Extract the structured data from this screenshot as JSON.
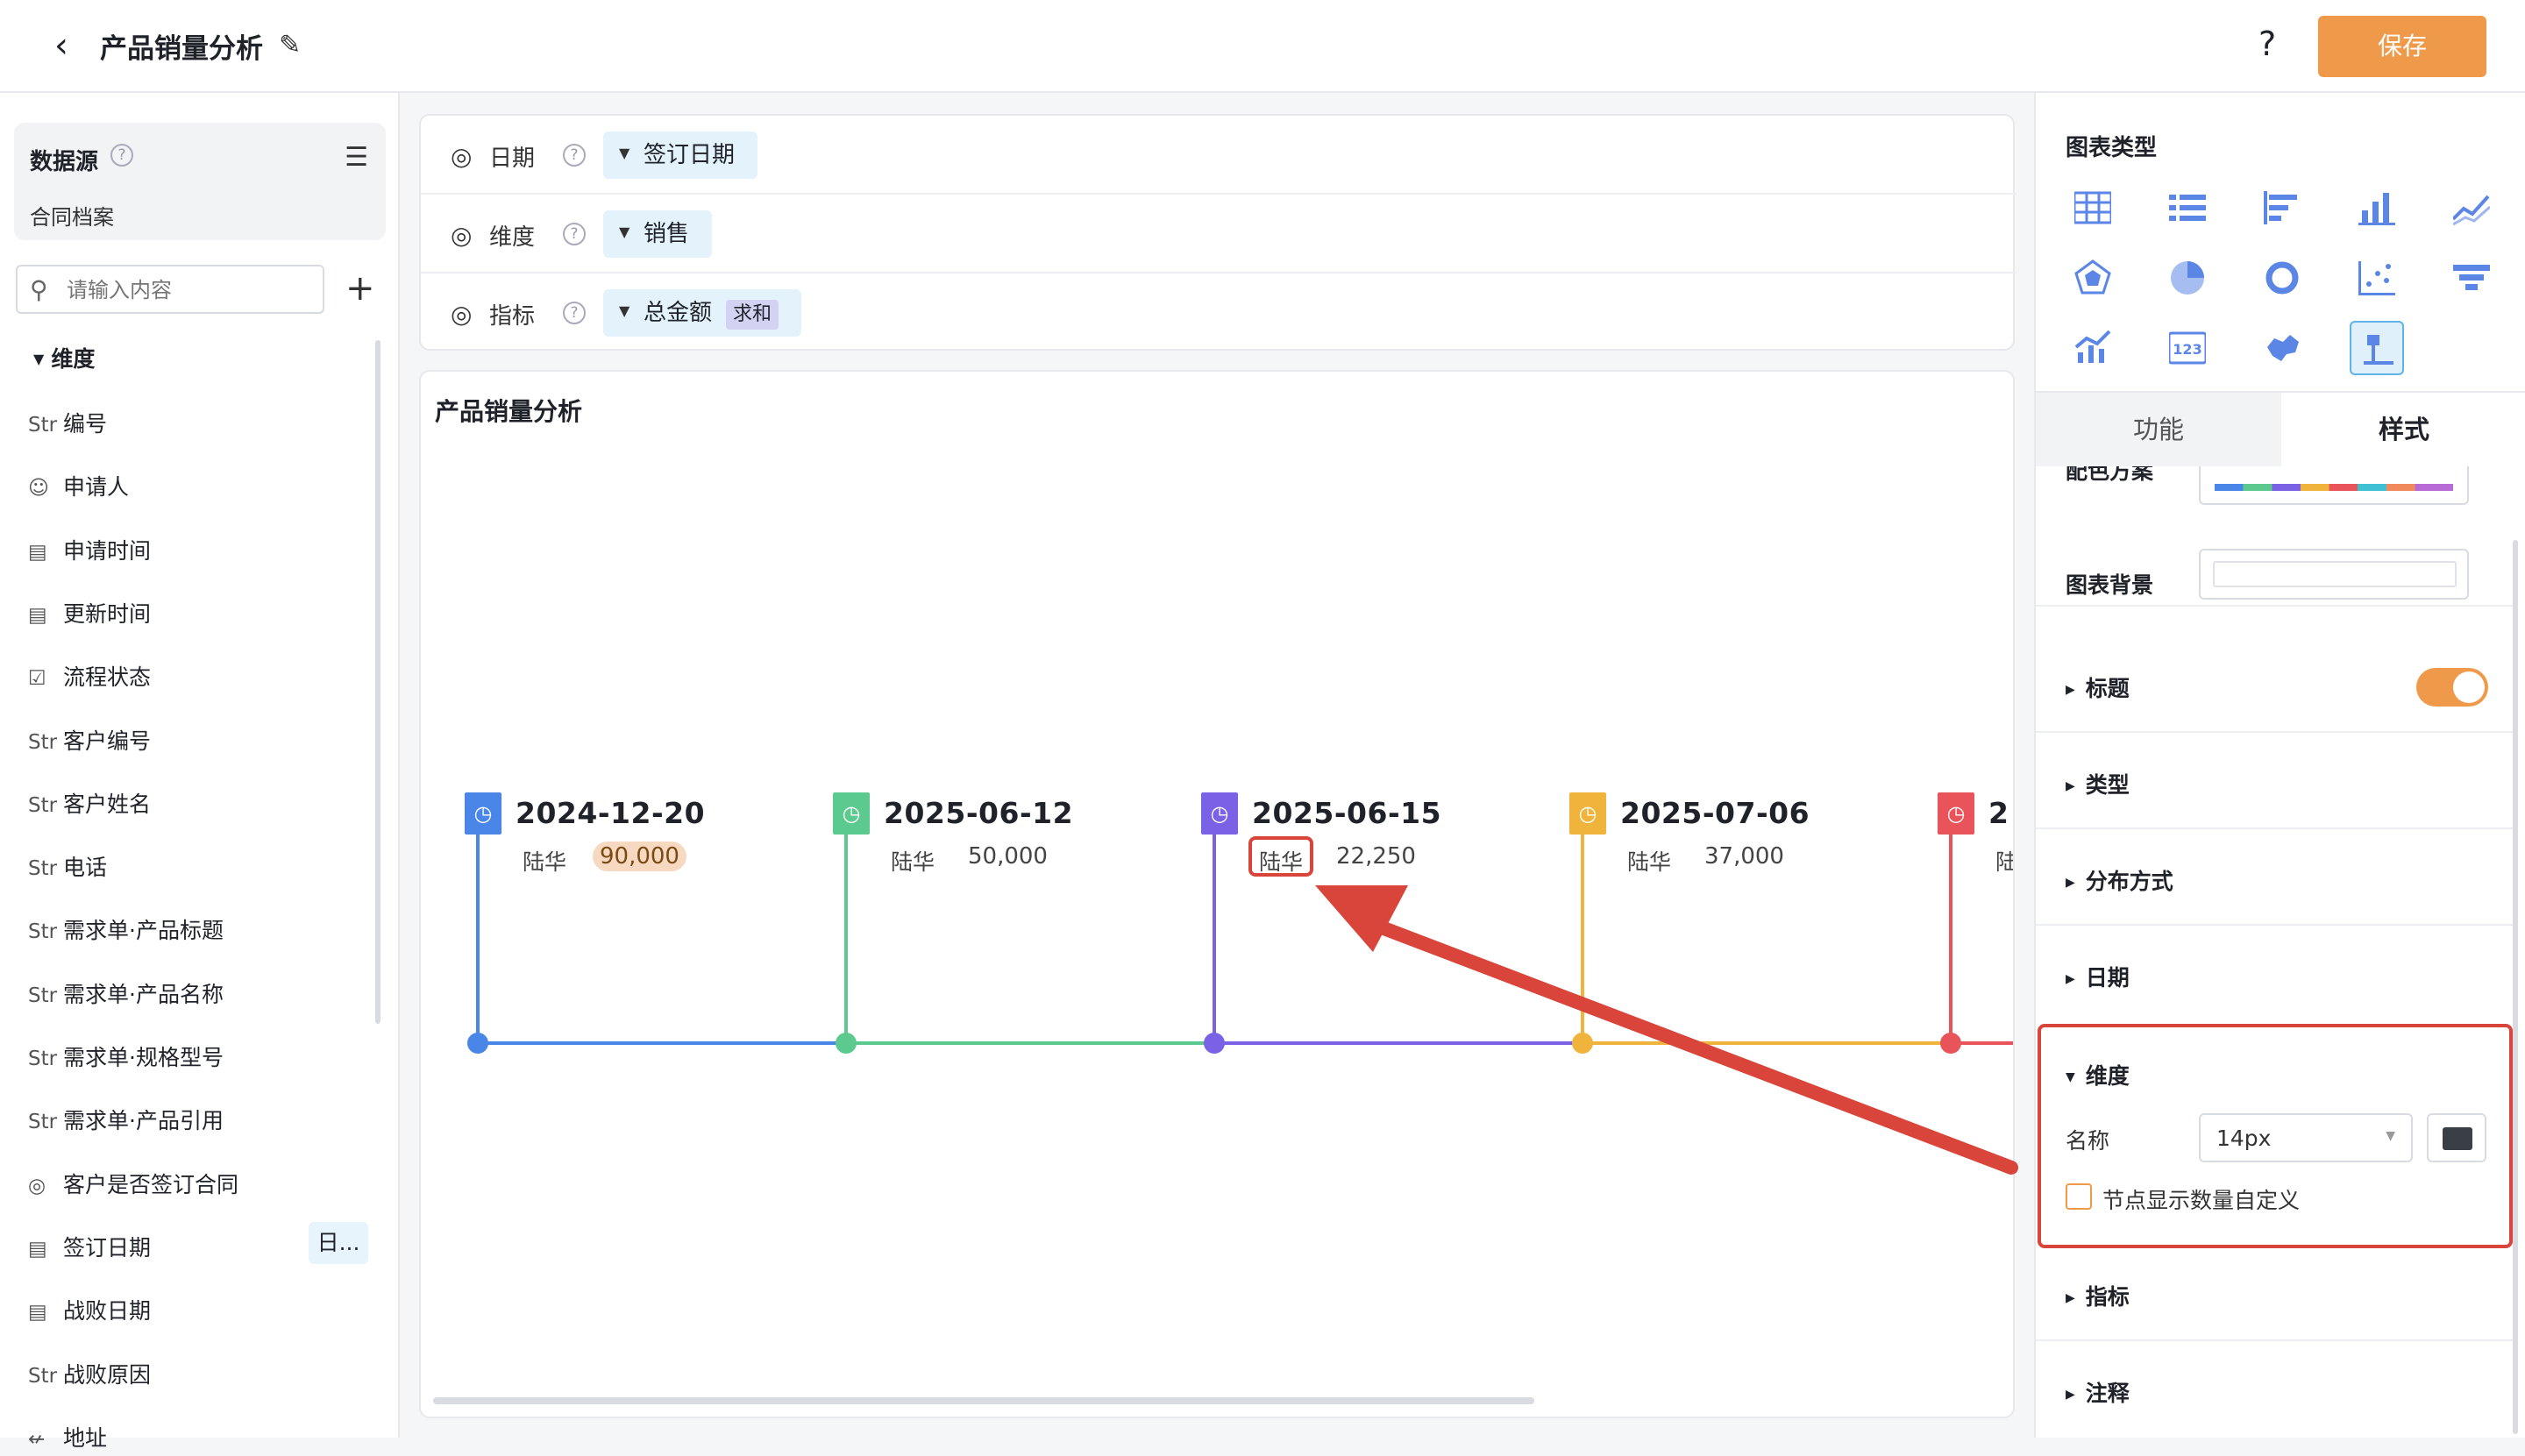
{
  "topbar": {
    "title": "产品销量分析",
    "save_label": "保存",
    "help": "?"
  },
  "left": {
    "datasource_label": "数据源",
    "datasource_name": "合同档案",
    "search_placeholder": "请输入内容",
    "dimension_header": "维度",
    "fields": [
      {
        "type": "Str",
        "name": "编号",
        "icon": "string-icon"
      },
      {
        "type": "person",
        "name": "申请人",
        "icon": "person-icon"
      },
      {
        "type": "date",
        "name": "申请时间",
        "icon": "calendar-icon"
      },
      {
        "type": "date",
        "name": "更新时间",
        "icon": "calendar-icon"
      },
      {
        "type": "check",
        "name": "流程状态",
        "icon": "checkbox-icon"
      },
      {
        "type": "Str",
        "name": "客户编号",
        "icon": "string-icon"
      },
      {
        "type": "Str",
        "name": "客户姓名",
        "icon": "string-icon"
      },
      {
        "type": "Str",
        "name": "电话",
        "icon": "string-icon"
      },
      {
        "type": "Str",
        "name": "需求单·产品标题",
        "icon": "string-icon"
      },
      {
        "type": "Str",
        "name": "需求单·产品名称",
        "icon": "string-icon"
      },
      {
        "type": "Str",
        "name": "需求单·规格型号",
        "icon": "string-icon"
      },
      {
        "type": "Str",
        "name": "需求单·产品引用",
        "icon": "string-icon"
      },
      {
        "type": "radio",
        "name": "客户是否签订合同",
        "icon": "radio-icon"
      },
      {
        "type": "date",
        "name": "签订日期",
        "icon": "calendar-icon",
        "tag": "日..."
      },
      {
        "type": "date",
        "name": "战败日期",
        "icon": "calendar-icon"
      },
      {
        "type": "Str",
        "name": "战败原因",
        "icon": "string-icon"
      },
      {
        "type": "geo",
        "name": "地址",
        "icon": "location-icon"
      }
    ]
  },
  "config": {
    "rows": [
      {
        "label": "日期",
        "value": "签订日期"
      },
      {
        "label": "维度",
        "value": "销售"
      },
      {
        "label": "指标",
        "value": "总金额",
        "agg": "求和"
      }
    ]
  },
  "chart": {
    "title": "产品销量分析",
    "nodes": [
      {
        "date": "2024-12-20",
        "person": "陆华",
        "amount": "90,000",
        "color": "#4a86e8"
      },
      {
        "date": "2025-06-12",
        "person": "陆华",
        "amount": "50,000",
        "color": "#5cc98f"
      },
      {
        "date": "2025-06-15",
        "person": "陆华",
        "amount": "22,250",
        "color": "#7b61e6"
      },
      {
        "date": "2025-07-06",
        "person": "陆华",
        "amount": "37,000",
        "color": "#f0b43c"
      },
      {
        "date": "2",
        "person": "陆",
        "amount": "",
        "color": "#e9545a"
      }
    ]
  },
  "right": {
    "chart_type_header": "图表类型",
    "tab_function": "功能",
    "tab_style": "样式",
    "color_scheme_label": "配色方案",
    "background_label": "图表背景",
    "sections": [
      "标题",
      "类型",
      "分布方式",
      "日期"
    ],
    "dimension_section": {
      "title": "维度",
      "name_label": "名称",
      "font_size": "14px",
      "checkbox_label": "节点显示数量自定义"
    },
    "sections_after": [
      "指标",
      "注释"
    ]
  },
  "colors": {
    "accent": "#ef9a4b",
    "annotation": "#d9453b"
  }
}
